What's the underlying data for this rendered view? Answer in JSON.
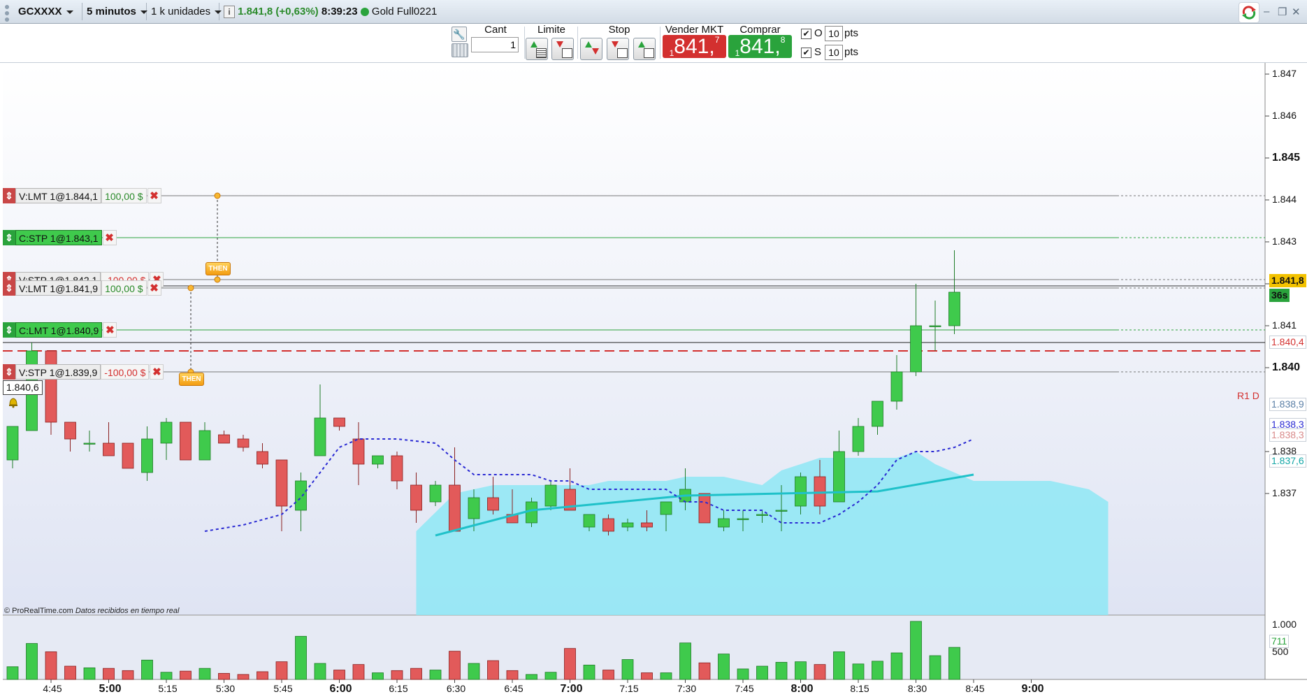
{
  "topbar": {
    "instrument": "GCXXXX",
    "timeframe": "5 minutos",
    "units": "1 k unidades",
    "info_icon": "info-icon",
    "last_price": "1.841,8",
    "change": "(+0,63%)",
    "time": "8:39:23",
    "status_color": "#2aa33c",
    "feed_name": "Gold Full0221"
  },
  "toolbar": {
    "wrench_icon": "wrench-icon",
    "keyboard_icon": "keyboard-icon",
    "cant_label": "Cant",
    "cant_value": "1",
    "limite_label": "Limite",
    "stop_label": "Stop",
    "vender_label": "Vender MKT",
    "comprar_label": "Comprar MKT",
    "vender_prefix": "1",
    "vender_main": "841,",
    "vender_sup": "7",
    "comprar_prefix": "1",
    "comprar_main": "841,",
    "comprar_sup": "8",
    "o_label": "O",
    "o_value": "10",
    "o_unit": "pts",
    "s_label": "S",
    "s_value": "10",
    "s_unit": "pts",
    "sell_color": "#d3302f",
    "buy_color": "#2aa33c"
  },
  "orders": [
    {
      "label": "V:LMT 1@1.844,1",
      "pnl": "100,00 $",
      "side": "sell",
      "price": 1844.1
    },
    {
      "label": "C:STP 1@1.843,1",
      "pnl": "",
      "side": "buy",
      "price": 1843.1
    },
    {
      "label": "V:STP 1@1.842,1",
      "pnl": "-100,00 $",
      "side": "sell",
      "price": 1842.1
    },
    {
      "label": "V:LMT 1@1.841,9",
      "pnl": "100,00 $",
      "side": "sell",
      "price": 1841.9
    },
    {
      "label": "C:LMT 1@1.840,9",
      "pnl": "",
      "side": "buy",
      "price": 1840.9
    },
    {
      "label": "V:STP 1@1.839,9",
      "pnl": "-100,00 $",
      "side": "sell",
      "price": 1839.9
    }
  ],
  "then_label": "THEN",
  "position_label": "1.840,6",
  "bell_icon": "bell-icon",
  "r1_label": "R1 D",
  "watermark": "© ProRealTime.com",
  "watermark_note": "Datos recibidos en tiempo real",
  "axis": {
    "ticks": [
      "1.847",
      "1.846",
      "1.845",
      "1.844",
      "1.843",
      "1.842",
      "1.841",
      "1.840",
      "1.838",
      "1.837"
    ],
    "labels_right": [
      {
        "text": "1.841,8",
        "bg": "#f3c200",
        "fg": "#111"
      },
      {
        "text": "36s",
        "bg": "#2aa33c",
        "fg": "#111"
      },
      {
        "text": "1.840,4",
        "bg": "#ffffff",
        "fg": "#d3302f"
      },
      {
        "text": "1.838,9",
        "bg": "#ffffff",
        "fg": "#5a7fa6"
      },
      {
        "text": "1.838,3",
        "bg": "#ffffff",
        "fg": "#2a2ad3"
      },
      {
        "text": "1.838,3",
        "bg": "#ffffff",
        "fg": "#d98a8a"
      },
      {
        "text": "1.837,6",
        "bg": "#ffffff",
        "fg": "#14a7a7"
      }
    ],
    "volume_ticks": [
      "1.000",
      "500"
    ],
    "volume_label": "711",
    "time_labels": [
      "4:45",
      "5:00",
      "5:15",
      "5:30",
      "5:45",
      "6:00",
      "6:15",
      "6:30",
      "6:45",
      "7:00",
      "7:15",
      "7:30",
      "7:45",
      "8:00",
      "8:15",
      "8:30",
      "8:45",
      "9:00"
    ],
    "time_bold": [
      "5:00",
      "6:00",
      "7:00",
      "8:00",
      "9:00"
    ]
  },
  "chart_data": {
    "type": "candlestick",
    "instrument": "GCXXXX",
    "timeframe": "5 minutos",
    "ylim": [
      1836.15,
      1847.25
    ],
    "volume_ylim": [
      0,
      1150
    ],
    "first_bar_time": "4:35",
    "bars": [
      {
        "o": 1837.8,
        "h": 1838.6,
        "l": 1837.6,
        "c": 1838.6,
        "v": 230
      },
      {
        "o": 1838.5,
        "h": 1840.6,
        "l": 1838.5,
        "c": 1840.4,
        "v": 650
      },
      {
        "o": 1840.4,
        "h": 1840.4,
        "l": 1838.4,
        "c": 1838.7,
        "v": 500
      },
      {
        "o": 1838.7,
        "h": 1838.7,
        "l": 1838.0,
        "c": 1838.3,
        "v": 240
      },
      {
        "o": 1838.2,
        "h": 1838.5,
        "l": 1838.0,
        "c": 1838.2,
        "v": 210
      },
      {
        "o": 1838.2,
        "h": 1838.7,
        "l": 1837.9,
        "c": 1837.9,
        "v": 200
      },
      {
        "o": 1838.2,
        "h": 1838.2,
        "l": 1837.6,
        "c": 1837.6,
        "v": 160
      },
      {
        "o": 1837.5,
        "h": 1838.6,
        "l": 1837.3,
        "c": 1838.3,
        "v": 350
      },
      {
        "o": 1838.2,
        "h": 1838.8,
        "l": 1837.8,
        "c": 1838.7,
        "v": 130
      },
      {
        "o": 1838.7,
        "h": 1838.7,
        "l": 1837.8,
        "c": 1837.8,
        "v": 150
      },
      {
        "o": 1837.8,
        "h": 1838.7,
        "l": 1837.8,
        "c": 1838.5,
        "v": 200
      },
      {
        "o": 1838.4,
        "h": 1838.5,
        "l": 1838.2,
        "c": 1838.2,
        "v": 110
      },
      {
        "o": 1838.3,
        "h": 1838.4,
        "l": 1838.0,
        "c": 1838.1,
        "v": 90
      },
      {
        "o": 1838.0,
        "h": 1838.2,
        "l": 1837.6,
        "c": 1837.7,
        "v": 140
      },
      {
        "o": 1837.8,
        "h": 1837.8,
        "l": 1836.1,
        "c": 1836.7,
        "v": 320
      },
      {
        "o": 1836.6,
        "h": 1837.5,
        "l": 1836.1,
        "c": 1837.3,
        "v": 780
      },
      {
        "o": 1837.9,
        "h": 1839.6,
        "l": 1837.9,
        "c": 1838.8,
        "v": 290
      },
      {
        "o": 1838.8,
        "h": 1838.8,
        "l": 1838.5,
        "c": 1838.6,
        "v": 170
      },
      {
        "o": 1838.3,
        "h": 1838.7,
        "l": 1837.2,
        "c": 1837.7,
        "v": 270
      },
      {
        "o": 1837.7,
        "h": 1837.9,
        "l": 1837.6,
        "c": 1837.9,
        "v": 120
      },
      {
        "o": 1837.9,
        "h": 1838.0,
        "l": 1837.1,
        "c": 1837.3,
        "v": 160
      },
      {
        "o": 1837.2,
        "h": 1837.5,
        "l": 1836.3,
        "c": 1836.6,
        "v": 200
      },
      {
        "o": 1836.8,
        "h": 1837.3,
        "l": 1836.7,
        "c": 1837.2,
        "v": 170
      },
      {
        "o": 1837.2,
        "h": 1838.1,
        "l": 1836.1,
        "c": 1836.1,
        "v": 510
      },
      {
        "o": 1836.4,
        "h": 1837.1,
        "l": 1836.1,
        "c": 1836.9,
        "v": 290
      },
      {
        "o": 1836.9,
        "h": 1837.4,
        "l": 1836.5,
        "c": 1836.6,
        "v": 340
      },
      {
        "o": 1836.5,
        "h": 1837.1,
        "l": 1836.3,
        "c": 1836.3,
        "v": 160
      },
      {
        "o": 1836.3,
        "h": 1836.9,
        "l": 1836.2,
        "c": 1836.8,
        "v": 90
      },
      {
        "o": 1836.7,
        "h": 1837.3,
        "l": 1836.6,
        "c": 1837.2,
        "v": 130
      },
      {
        "o": 1837.1,
        "h": 1837.6,
        "l": 1836.6,
        "c": 1836.6,
        "v": 560
      },
      {
        "o": 1836.2,
        "h": 1836.5,
        "l": 1836.1,
        "c": 1836.5,
        "v": 260
      },
      {
        "o": 1836.4,
        "h": 1836.5,
        "l": 1836.0,
        "c": 1836.1,
        "v": 170
      },
      {
        "o": 1836.2,
        "h": 1836.4,
        "l": 1836.1,
        "c": 1836.3,
        "v": 360
      },
      {
        "o": 1836.3,
        "h": 1836.6,
        "l": 1836.1,
        "c": 1836.2,
        "v": 120
      },
      {
        "o": 1836.5,
        "h": 1836.8,
        "l": 1836.1,
        "c": 1836.8,
        "v": 120
      },
      {
        "o": 1836.8,
        "h": 1837.6,
        "l": 1836.6,
        "c": 1837.1,
        "v": 660
      },
      {
        "o": 1837.0,
        "h": 1837.0,
        "l": 1836.3,
        "c": 1836.3,
        "v": 300
      },
      {
        "o": 1836.2,
        "h": 1836.6,
        "l": 1836.1,
        "c": 1836.4,
        "v": 460
      },
      {
        "o": 1836.4,
        "h": 1836.6,
        "l": 1836.1,
        "c": 1836.4,
        "v": 190
      },
      {
        "o": 1836.5,
        "h": 1836.6,
        "l": 1836.3,
        "c": 1836.5,
        "v": 240
      },
      {
        "o": 1836.6,
        "h": 1837.2,
        "l": 1836.1,
        "c": 1836.6,
        "v": 310
      },
      {
        "o": 1836.7,
        "h": 1837.5,
        "l": 1836.5,
        "c": 1837.4,
        "v": 320
      },
      {
        "o": 1837.4,
        "h": 1837.8,
        "l": 1836.5,
        "c": 1836.7,
        "v": 270
      },
      {
        "o": 1836.8,
        "h": 1838.5,
        "l": 1836.8,
        "c": 1838.0,
        "v": 500
      },
      {
        "o": 1838.0,
        "h": 1838.8,
        "l": 1837.9,
        "c": 1838.6,
        "v": 280
      },
      {
        "o": 1838.6,
        "h": 1839.2,
        "l": 1838.4,
        "c": 1839.2,
        "v": 330
      },
      {
        "o": 1839.2,
        "h": 1840.3,
        "l": 1839.0,
        "c": 1839.9,
        "v": 480
      },
      {
        "o": 1839.9,
        "h": 1842.0,
        "l": 1839.8,
        "c": 1841.0,
        "v": 1050
      },
      {
        "o": 1841.0,
        "h": 1841.6,
        "l": 1840.4,
        "c": 1841.0,
        "v": 430
      },
      {
        "o": 1841.0,
        "h": 1842.8,
        "l": 1840.8,
        "c": 1841.8,
        "v": 580
      }
    ],
    "ma_line": [
      [
        22,
        1836.0
      ],
      [
        27,
        1836.6
      ],
      [
        35,
        1836.95
      ],
      [
        40,
        1837.0
      ],
      [
        45,
        1837.05
      ],
      [
        50,
        1837.45
      ]
    ],
    "dotted_line": [
      [
        10,
        1836.1
      ],
      [
        12,
        1836.25
      ],
      [
        14,
        1836.5
      ],
      [
        15,
        1836.9
      ],
      [
        16,
        1837.5
      ],
      [
        17,
        1838.1
      ],
      [
        18,
        1838.3
      ],
      [
        20,
        1838.3
      ],
      [
        22,
        1838.2
      ],
      [
        23,
        1837.8
      ],
      [
        24,
        1837.45
      ],
      [
        27,
        1837.45
      ],
      [
        28,
        1837.3
      ],
      [
        29,
        1837.3
      ],
      [
        30,
        1837.1
      ],
      [
        34,
        1837.1
      ],
      [
        35,
        1836.8
      ],
      [
        36,
        1836.8
      ],
      [
        37,
        1836.6
      ],
      [
        39,
        1836.6
      ],
      [
        40,
        1836.3
      ],
      [
        42,
        1836.3
      ],
      [
        43,
        1836.5
      ],
      [
        44,
        1836.8
      ],
      [
        45,
        1837.2
      ],
      [
        46,
        1837.8
      ],
      [
        47,
        1838.0
      ],
      [
        48,
        1838.0
      ],
      [
        49,
        1838.1
      ],
      [
        50,
        1838.3
      ]
    ],
    "cloud_upper": [
      [
        21,
        1836.1
      ],
      [
        23,
        1837.0
      ],
      [
        25,
        1837.2
      ],
      [
        30,
        1837.2
      ],
      [
        31,
        1837.3
      ],
      [
        34,
        1837.3
      ],
      [
        35,
        1837.4
      ],
      [
        37,
        1837.4
      ],
      [
        39,
        1837.2
      ],
      [
        40,
        1837.55
      ],
      [
        42,
        1837.85
      ],
      [
        46,
        1837.85
      ],
      [
        47,
        1838.0
      ],
      [
        48,
        1837.7
      ],
      [
        49,
        1837.5
      ],
      [
        50,
        1837.3
      ],
      [
        54,
        1837.3
      ],
      [
        56,
        1837.1
      ],
      [
        57,
        1836.8
      ]
    ],
    "r1_d": 1840.4,
    "current_price": 1841.8
  }
}
